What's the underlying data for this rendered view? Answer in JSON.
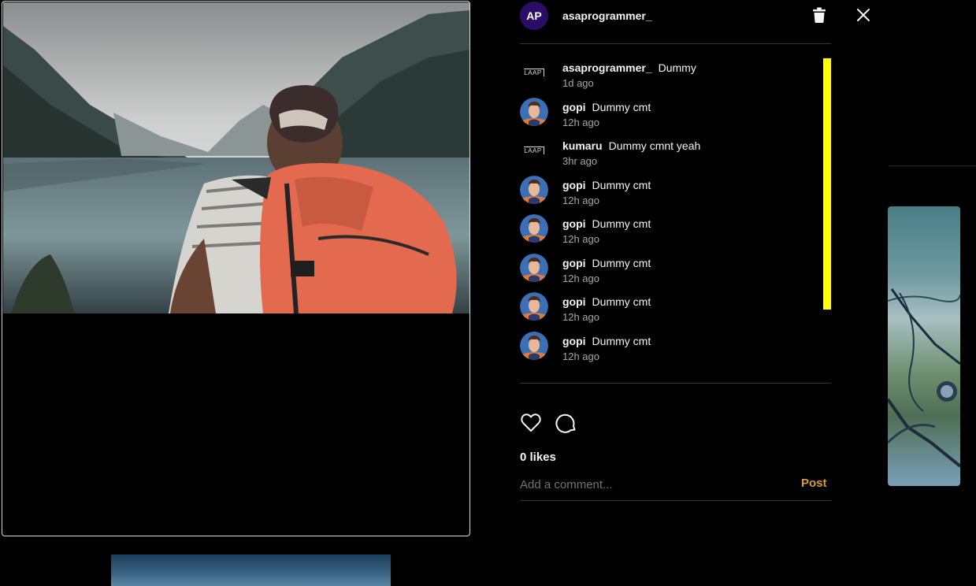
{
  "post": {
    "author_initials": "AP",
    "author": "asaprogrammer_",
    "likes_text": "0 likes",
    "comment_placeholder": "Add a comment...",
    "post_label": "Post"
  },
  "comments": [
    {
      "user": "asaprogrammer_",
      "text": "Dummy",
      "time": "1d ago",
      "avatar": "laap-logo"
    },
    {
      "user": "gopi",
      "text": "Dummy cmt",
      "time": "12h ago",
      "avatar": "photo"
    },
    {
      "user": "kumaru",
      "text": "Dummy cmnt yeah",
      "time": "3hr ago",
      "avatar": "laap-logo"
    },
    {
      "user": "gopi",
      "text": "Dummy cmt",
      "time": "12h ago",
      "avatar": "photo"
    },
    {
      "user": "gopi",
      "text": "Dummy cmt",
      "time": "12h ago",
      "avatar": "photo"
    },
    {
      "user": "gopi",
      "text": "Dummy cmt",
      "time": "12h ago",
      "avatar": "photo"
    },
    {
      "user": "gopi",
      "text": "Dummy cmt",
      "time": "12h ago",
      "avatar": "photo"
    },
    {
      "user": "gopi",
      "text": "Dummy cmt",
      "time": "12h ago",
      "avatar": "photo"
    }
  ],
  "logo_text": "LAAP",
  "icons": {
    "delete": "trash-icon",
    "close": "close-icon",
    "like": "heart-icon",
    "comment": "comment-bubble-icon"
  },
  "colors": {
    "accent_post": "#d99a3a",
    "avatar_bg": "#2a0e66",
    "scrollbar": "#ffff00"
  }
}
